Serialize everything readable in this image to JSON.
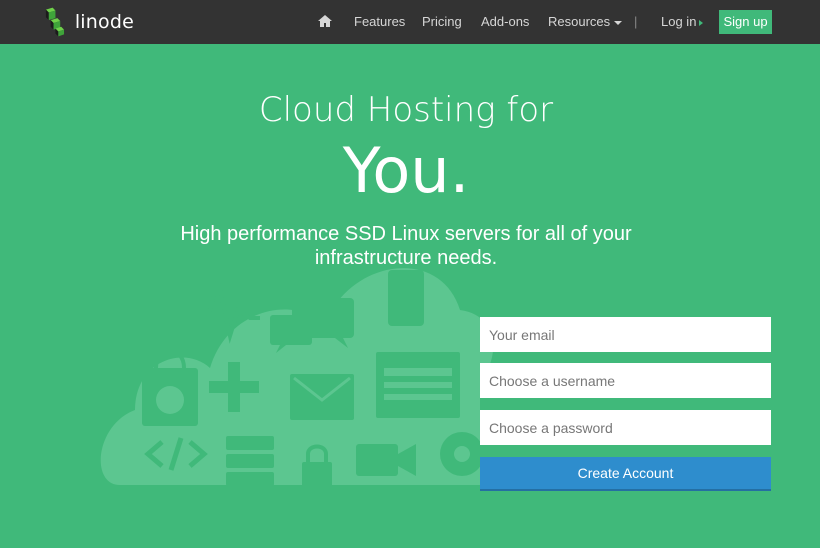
{
  "nav": {
    "brand": "linode",
    "items": [
      {
        "label": "Features"
      },
      {
        "label": "Pricing"
      },
      {
        "label": "Add-ons"
      },
      {
        "label": "Resources"
      }
    ],
    "separator": "|",
    "login": "Log in",
    "signup": "Sign up"
  },
  "hero": {
    "line1": "Cloud Hosting for",
    "line2": "You.",
    "subtitle": "High performance SSD Linux servers for all of your infrastructure needs."
  },
  "form": {
    "email_placeholder": "Your email",
    "username_placeholder": "Choose a username",
    "password_placeholder": "Choose a password",
    "submit": "Create Account"
  },
  "colors": {
    "background": "#40b97a",
    "navbar": "#333333",
    "button_primary": "#2e8dcd",
    "accent": "#40b97a"
  },
  "icons": [
    "home-icon",
    "cloud-icon",
    "pulse-icon",
    "chat-icon",
    "mobile-icon",
    "shopping-bag-icon",
    "dpad-icon",
    "envelope-icon",
    "browser-window-icon",
    "code-icon",
    "server-stack-icon",
    "lock-icon",
    "video-camera-icon",
    "gear-icon"
  ]
}
